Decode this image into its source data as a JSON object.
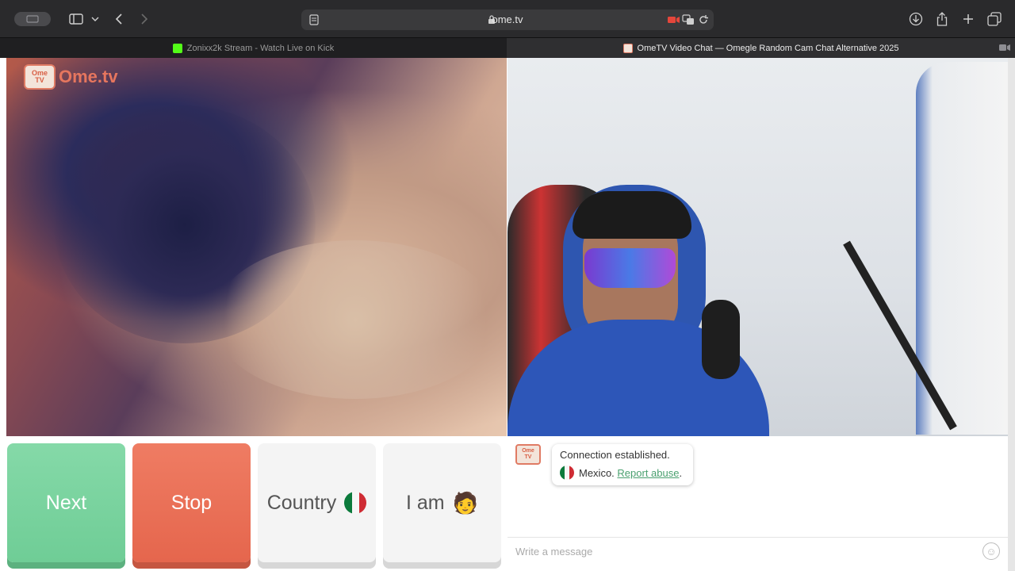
{
  "toolbar": {
    "url": "ome.tv",
    "icons": [
      "sidebar-toggle-icon",
      "chevron-down-icon",
      "back-icon",
      "forward-icon",
      "reader-icon",
      "lock-icon",
      "camera-recording-icon",
      "translate-icon",
      "reload-icon",
      "download-icon",
      "share-icon",
      "new-tab-icon",
      "tab-overview-icon"
    ]
  },
  "tabs": [
    {
      "title": "Zonixx2k Stream - Watch Live on Kick",
      "active": false
    },
    {
      "title": "OmeTV Video Chat — Omegle Random Cam Chat Alternative 2025",
      "active": true
    }
  ],
  "logo": {
    "top": "Ome",
    "bottom": "TV",
    "word": "Ome.tv"
  },
  "controls": {
    "next": "Next",
    "stop": "Stop",
    "country": "Country",
    "iam": "I am",
    "iam_emoji": "🧑"
  },
  "chat": {
    "logo_top": "Ome",
    "logo_bottom": "TV",
    "status": "Connection established.",
    "country": "Mexico.",
    "report": "Report abuse",
    "report_suffix": ".",
    "placeholder": "Write a message",
    "emoji_icon": "☺"
  },
  "colors": {
    "next": "#6fcd96",
    "stop": "#e5664d",
    "brand": "#e6765e",
    "link": "#4aa06f"
  }
}
